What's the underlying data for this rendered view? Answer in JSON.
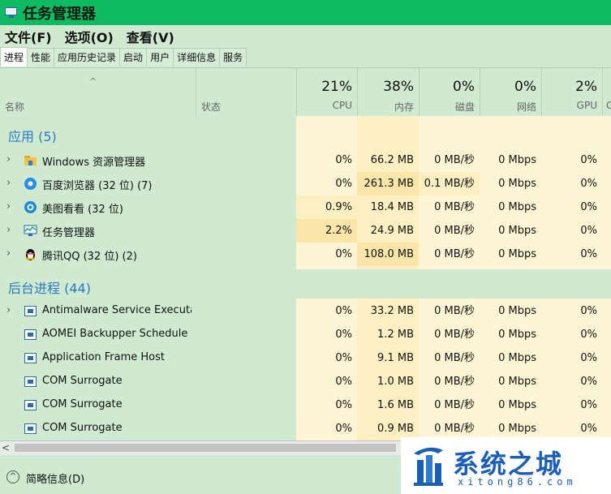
{
  "window": {
    "title": "任务管理器"
  },
  "menu": [
    "文件(F)",
    "选项(O)",
    "查看(V)"
  ],
  "tabs": [
    "进程",
    "性能",
    "应用历史记录",
    "启动",
    "用户",
    "详细信息",
    "服务"
  ],
  "columns": {
    "name": "名称",
    "status": "状态",
    "cpu": {
      "pct": "21%",
      "label": "CPU"
    },
    "mem": {
      "pct": "38%",
      "label": "内存"
    },
    "disk": {
      "pct": "0%",
      "label": "磁盘"
    },
    "net": {
      "pct": "0%",
      "label": "网络"
    },
    "gpu": {
      "pct": "2%",
      "label": "GPU"
    },
    "extra": {
      "label": "G"
    }
  },
  "groups": {
    "apps": "应用 (5)",
    "background": "后台进程 (44)"
  },
  "app_rows": [
    {
      "icon": "folder-icon",
      "name": "Windows 资源管理器",
      "cpu": "0%",
      "mem": "66.2 MB",
      "disk": "0 MB/秒",
      "net": "0 Mbps",
      "gpu": "0%"
    },
    {
      "icon": "baidu-browser-icon",
      "name": "百度浏览器 (32 位) (7)",
      "cpu": "0%",
      "mem": "261.3 MB",
      "disk": "0.1 MB/秒",
      "net": "0 Mbps",
      "gpu": "0%"
    },
    {
      "icon": "meitu-icon",
      "name": "美图看看 (32 位)",
      "cpu": "0.9%",
      "mem": "18.4 MB",
      "disk": "0 MB/秒",
      "net": "0 Mbps",
      "gpu": "0%"
    },
    {
      "icon": "task-manager-icon",
      "name": "任务管理器",
      "cpu": "2.2%",
      "mem": "24.9 MB",
      "disk": "0 MB/秒",
      "net": "0 Mbps",
      "gpu": "0%"
    },
    {
      "icon": "qq-penguin-icon",
      "name": "腾讯QQ (32 位) (2)",
      "cpu": "0%",
      "mem": "108.0 MB",
      "disk": "0 MB/秒",
      "net": "0 Mbps",
      "gpu": "0%"
    }
  ],
  "bg_rows": [
    {
      "name": "Antimalware Service Executa...",
      "cpu": "0%",
      "mem": "33.2 MB",
      "disk": "0 MB/秒",
      "net": "0 Mbps",
      "gpu": "0%",
      "expand": true
    },
    {
      "name": "AOMEI Backupper Schedule ...",
      "cpu": "0%",
      "mem": "1.2 MB",
      "disk": "0 MB/秒",
      "net": "0 Mbps",
      "gpu": "0%",
      "expand": false
    },
    {
      "name": "Application Frame Host",
      "cpu": "0%",
      "mem": "9.1 MB",
      "disk": "0 MB/秒",
      "net": "0 Mbps",
      "gpu": "0%",
      "expand": false
    },
    {
      "name": "COM Surrogate",
      "cpu": "0%",
      "mem": "1.0 MB",
      "disk": "0 MB/秒",
      "net": "0 Mbps",
      "gpu": "0%",
      "expand": false
    },
    {
      "name": "COM Surrogate",
      "cpu": "0%",
      "mem": "1.6 MB",
      "disk": "0 MB/秒",
      "net": "0 Mbps",
      "gpu": "0%",
      "expand": false
    },
    {
      "name": "COM Surrogate",
      "cpu": "0%",
      "mem": "0.9 MB",
      "disk": "0 MB/秒",
      "net": "0 Mbps",
      "gpu": "0%",
      "expand": false
    }
  ],
  "footer": {
    "fewer_details": "简略信息(D)"
  },
  "watermark": {
    "title": "系统之城",
    "subtitle": "xitong86.com"
  },
  "colors": {
    "titlebar": "#0ebb63",
    "group_title": "#2b79c2",
    "heat_light": "#fdf5d3",
    "heat_mid": "#fcefc1",
    "heat_strong": "#f9e6a8"
  }
}
